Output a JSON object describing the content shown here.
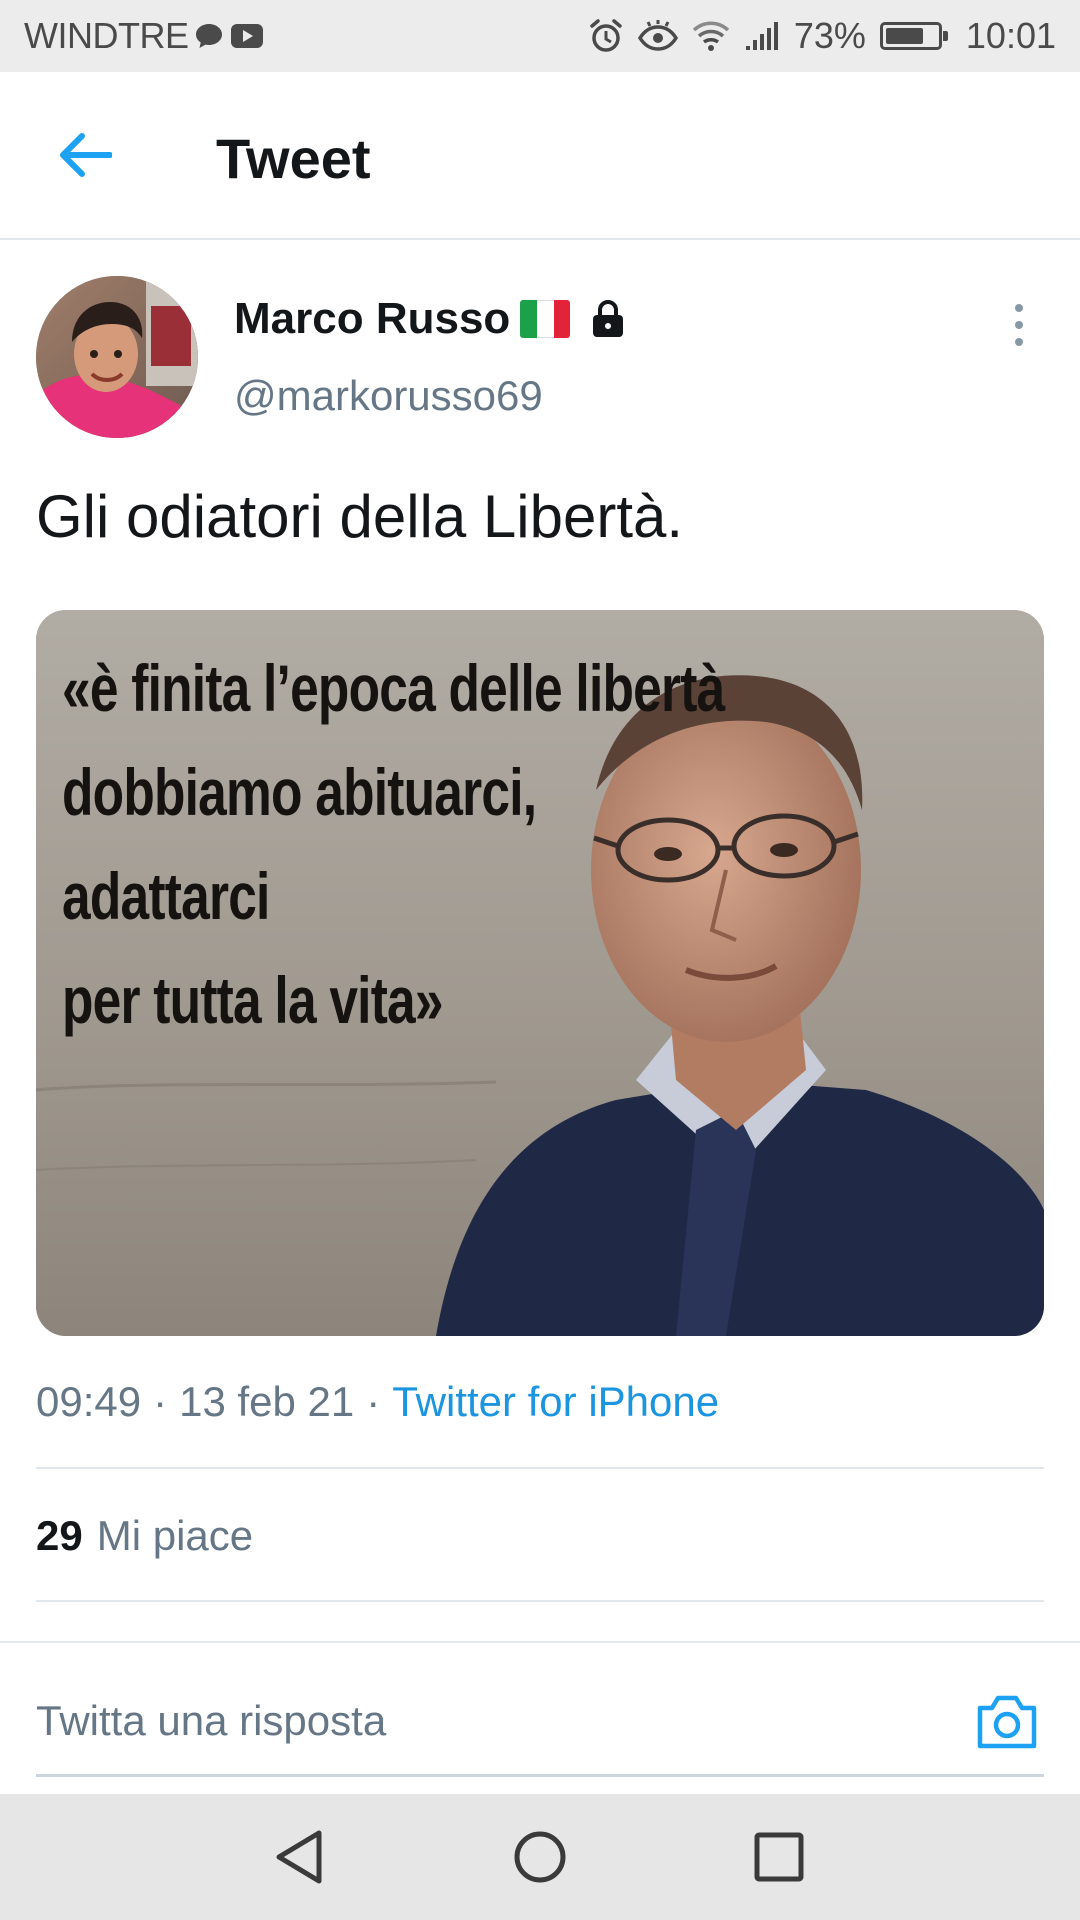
{
  "status_bar": {
    "carrier": "WINDTRE",
    "battery_percent": "73%",
    "battery_level": 0.73,
    "time": "10:01"
  },
  "header": {
    "title": "Tweet"
  },
  "tweet": {
    "author_name": "Marco Russo",
    "handle": "@markorusso69",
    "text": "Gli odiatori della Libertà.",
    "media_quote": {
      "line1": "«è finita l’epoca delle libertà",
      "line2": "dobbiamo abituarci,",
      "line3": "adattarci",
      "line4": "per tutta la vita»"
    },
    "time": "09:49",
    "date": "13 feb 21",
    "separator": "·",
    "source": "Twitter for iPhone",
    "likes_count": "29",
    "likes_label": "Mi piace"
  },
  "reply": {
    "placeholder": "Twitta una risposta"
  },
  "colors": {
    "accent": "#1da1f2",
    "link": "#1b95e0",
    "secondary_text": "#657786"
  }
}
